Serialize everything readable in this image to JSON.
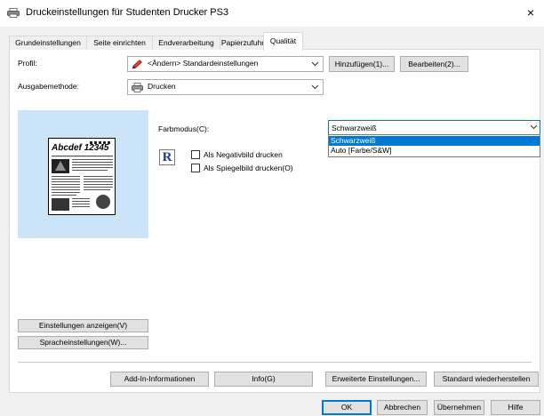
{
  "window": {
    "title": "Druckeinstellungen für Studenten Drucker PS3",
    "close_glyph": "×"
  },
  "tabs": [
    {
      "label": "Grundeinstellungen",
      "active": false
    },
    {
      "label": "Seite einrichten",
      "active": false
    },
    {
      "label": "Endverarbeitung",
      "active": false
    },
    {
      "label": "Papierzufuhr",
      "active": false
    },
    {
      "label": "Qualität",
      "active": true
    }
  ],
  "profile": {
    "label": "Profil:",
    "value": "<Ändern> Standardeinstellungen",
    "icon": "pencil-icon",
    "add_button": "Hinzufügen(1)...",
    "edit_button": "Bearbeiten(2)..."
  },
  "output": {
    "label": "Ausgabemethode:",
    "value": "Drucken",
    "icon": "printer-icon"
  },
  "preview": {
    "doc_heading": "Abcdef 12345",
    "show_settings_button": "Einstellungen anzeigen(V)",
    "language_button": "Spracheinstellungen(W)..."
  },
  "quality": {
    "color_mode_label": "Farbmodus(C):",
    "color_mode_value": "Schwarzweiß",
    "color_mode_options": [
      "Schwarzweiß",
      "Auto [Farbe/S&W]"
    ],
    "selected_option_index": 0,
    "negative_label": "Als Negativbild drucken",
    "negative_checked": false,
    "mirror_label": "Als Spiegelbild drucken(O)",
    "mirror_checked": false,
    "r_icon_glyph": "R"
  },
  "bottom_panel_buttons": {
    "addin": "Add-In-Informationen",
    "info": "Info(G)",
    "advanced": "Erweiterte Einstellungen...",
    "restore": "Standard wiederherstellen"
  },
  "dialog_buttons": {
    "ok": "OK",
    "cancel": "Abbrechen",
    "apply": "Übernehmen",
    "help": "Hilfe"
  },
  "colors": {
    "selection": "#0078d7",
    "preview_background": "#cce4f7",
    "dialog_background": "#f0f0f0",
    "pencil": "#e03c28"
  }
}
